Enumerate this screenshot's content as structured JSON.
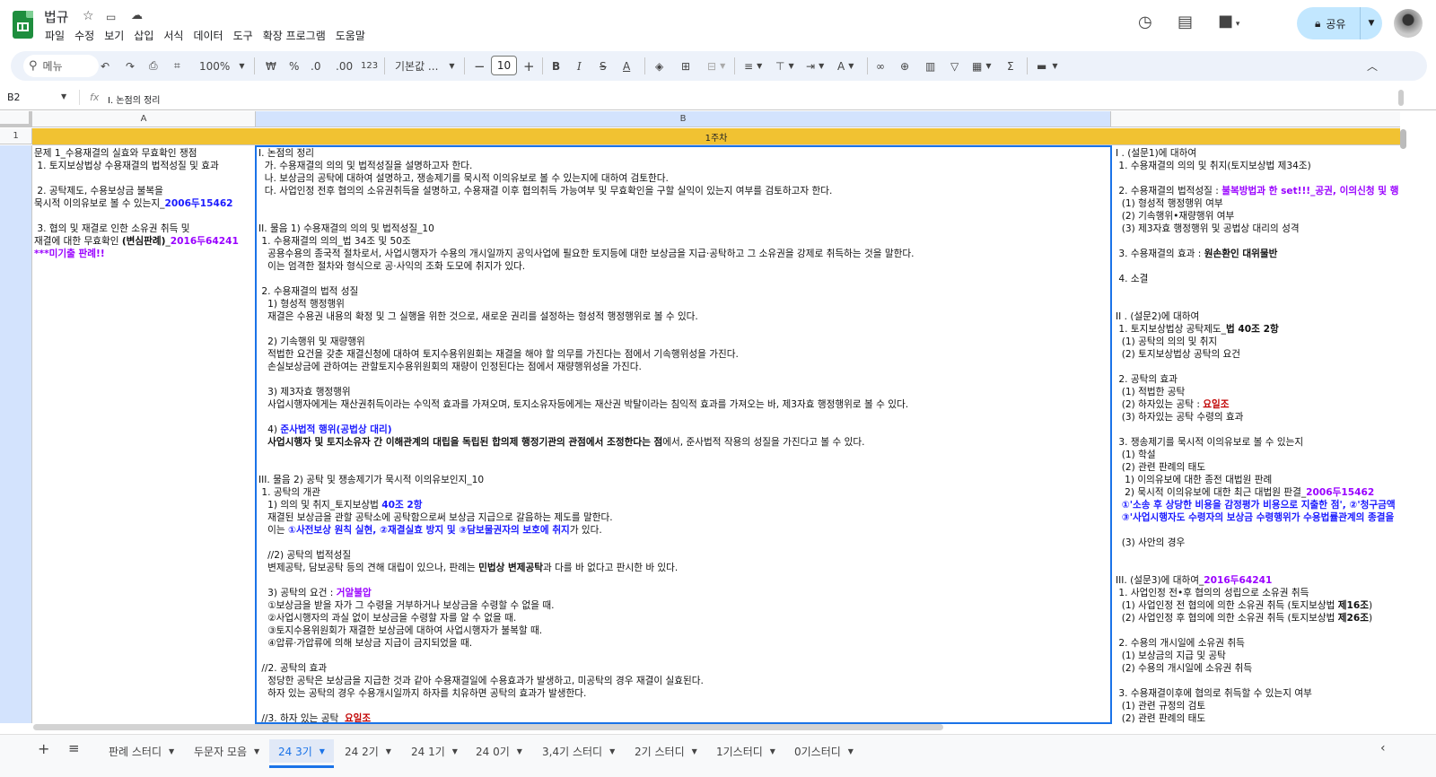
{
  "doc": {
    "title": "법규",
    "menu": [
      "파일",
      "수정",
      "보기",
      "삽입",
      "서식",
      "데이터",
      "도구",
      "확장 프로그램",
      "도움말"
    ]
  },
  "share": {
    "label": "공유"
  },
  "toolbar": {
    "search": "메뉴",
    "zoom": "100%",
    "currency": "₩",
    "percent": "%",
    "dec_less": ".0",
    "dec_more": ".00",
    "num_format": "123",
    "font": "기본값 ...",
    "font_size": "10"
  },
  "formula": {
    "cell_ref": "B2",
    "content": "I. 논점의 정리"
  },
  "columns": [
    "A",
    "B"
  ],
  "rows": [
    "1"
  ],
  "week_label": "1주차",
  "cells": {
    "a": "문제 1_수용재결의 실효와 무효확인 쟁점\n 1. 토지보상법상 수용재결의 법적성질 및 효과\n\n 2. 공탁제도, 수용보상금 불복을\n묵시적 이의유보로 볼 수 있는지_2006두15462\n\n 3. 협의 및 재결로 인한 소유권 취득 및\n재결에 대한 무효확인 (변심판례)_2016두64241\n***미기출 판례!!",
    "b": "I. 논점의 정리\n  가. 수용재결의 의의 및 법적성질을 설명하고자 한다.\n  나. 보상금의 공탁에 대하여 설명하고, 쟁송제기를 묵시적 이의유보로 볼 수 있는지에 대하여 검토한다.\n  다. 사업인정 전후 협의의 소유권취득을 설명하고, 수용재결 이후 협의취득 가능여부 및 무효확인을 구할 실익이 있는지 여부를 검토하고자 한다.\n\n\nII. 물음 1) 수용재결의 의의 및 법적성질_10\n 1. 수용재결의 의의_법 34조 및 50조\n   공용수용의 종국적 절차로서, 사업시행자가 수용의 개시일까지 공익사업에 필요한 토지등에 대한 보상금을 지급·공탁하고 그 소유권을 강제로 취득하는 것을 말한다.\n   이는 엄격한 절차와 형식으로 공·사익의 조화 도모에 취지가 있다.\n\n 2. 수용재결의 법적 성질\n   1) 형성적 행정행위\n   재결은 수용권 내용의 확정 및 그 실행을 위한 것으로, 새로운 권리를 설정하는 형성적 행정행위로 볼 수 있다.\n\n   2) 기속행위 및 재량행위\n   적법한 요건을 갖춘 재결신청에 대하여 토지수용위원회는 재결을 해야 할 의무를 가진다는 점에서 기속행위성을 가진다.\n   손실보상금에 관하여는 관할토지수용위원회의 재량이 인정된다는 점에서 재량행위성을 가진다.\n\n   3) 제3자효 행정행위\n   사업시행자에게는 재산권취득이라는 수익적 효과를 가져오며, 토지소유자등에게는 재산권 박탈이라는 침익적 효과를 가져오는 바, 제3자효 행정행위로 볼 수 있다.\n\n   4) 준사법적 행위(공법상 대리)\n   사업시행자 및 토지소유자 간 이해관계의 대립을 독립된 합의제 행정기관의 관점에서 조정한다는 점에서, 준사법적 작용의 성질을 가진다고 볼 수 있다.\n\n\nIII. 물음 2) 공탁 및 쟁송제기가 묵시적 이의유보인지_10\n 1. 공탁의 개관\n   1) 의의 및 취지_토지보상법 40조 2항\n   재결된 보상금을 관할 공탁소에 공탁함으로써 보상금 지급으로 갈음하는 제도를 말한다.\n   이는 ①사전보상 원칙 실현, ②재결실효 방지 및 ③담보물권자의 보호에 취지가 있다.\n\n   //2) 공탁의 법적성질\n   변제공탁, 담보공탁 등의 견해 대립이 있으나, 판례는 민법상 변제공탁과 다를 바 없다고 판시한 바 있다.\n\n   3) 공탁의 요건 : 거알불압\n   ①보상금을 받을 자가 그 수령을 거부하거나 보상금을 수령할 수 없을 때.\n   ②사업시행자의 과실 없이 보상금을 수령할 자를 알 수 없을 때.\n   ③토지수용위원회가 재결한 보상금에 대하여 사업시행자가 불복할 때.\n   ④압류·가압류에 의해 보상금 지급이 금지되었을 때.\n\n //2. 공탁의 효과\n   정당한 공탁은 보상금을 지급한 것과 같아 수용재결일에 수용효과가 발생하고, 미공탁의 경우 재결이 실효된다.\n   하자 있는 공탁의 경우 수용개시일까지 하자를 치유하면 공탁의 효과가 발생한다.\n\n //3. 하자 있는 공탁  요일조",
    "c": "I . (설문1)에 대하여\n 1. 수용재결의 의의 및 취지(토지보상법 제34조)\n\n 2. 수용재결의 법적성질 : 불복방법과 한 set!!!_공권, 이의신청 및 행정\n  (1) 형성적 행정행위 여부\n  (2) 기속행위•재량행위 여부\n  (3) 제3자효 행정행위 및 공법상 대리의 성격\n\n 3. 수용재결의 효과 : 원손환인 대위물반\n\n 4. 소결\n\n\nII . (설문2)에 대하여\n 1. 토지보상법상 공탁제도_법 40조 2항\n  (1) 공탁의 의의 및 취지\n  (2) 토지보상법상 공탁의 요건\n\n 2. 공탁의 효과\n  (1) 적법한 공탁\n  (2) 하자있는 공탁 : 요일조\n  (3) 하자있는 공탁 수령의 효과\n\n 3. 쟁송제기를 묵시적 이의유보로 볼 수 있는지\n  (1) 학설\n  (2) 관련 판례의 태도\n   1) 이의유보에 대한 종전 대법원 판례\n   2) 묵시적 이의유보에 대한 최근 대법원 판결_2006두15462\n  ①'소송 후 상당한 비용을 감정평가 비용으로 지출한 점', ②'청구금액\n  ③'사업시행자도 수령자의 보상금 수령행위가 수용법률관계의 종결을\n\n  (3) 사안의 경우\n\n\nIII. (설문3)에 대하여_2016두64241\n 1. 사업인정 전•후 협의의 성립으로 소유권 취득\n  (1) 사업인정 전 협의에 의한 소유권 취득 (토지보상법 제16조)\n  (2) 사업인정 후 협의에 의한 소유권 취득 (토지보상법 제26조)\n\n 2. 수용의 개시일에 소유권 취득\n  (1) 보상금의 지급 및 공탁\n  (2) 수용의 개시일에 소유권 취득\n\n 3. 수용재결이후에 협의로 취득할 수 있는지 여부\n  (1) 관련 규정의 검토\n  (2) 관련 판례의 태도"
  },
  "sheet_tabs": [
    "판례 스터디",
    "두문자 모음",
    "24 3기",
    "24 2기",
    "24 1기",
    "24 0기",
    "3,4기 스터디",
    "2기 스터디",
    "1기스터디",
    "0기스터디"
  ],
  "active_tab": "24 3기",
  "colors": {
    "accent": "#1a73e8",
    "week_header": "#f1c232",
    "highlight_blue": "#1a1aff",
    "highlight_purple": "#9900ff",
    "highlight_red": "#c00000"
  }
}
